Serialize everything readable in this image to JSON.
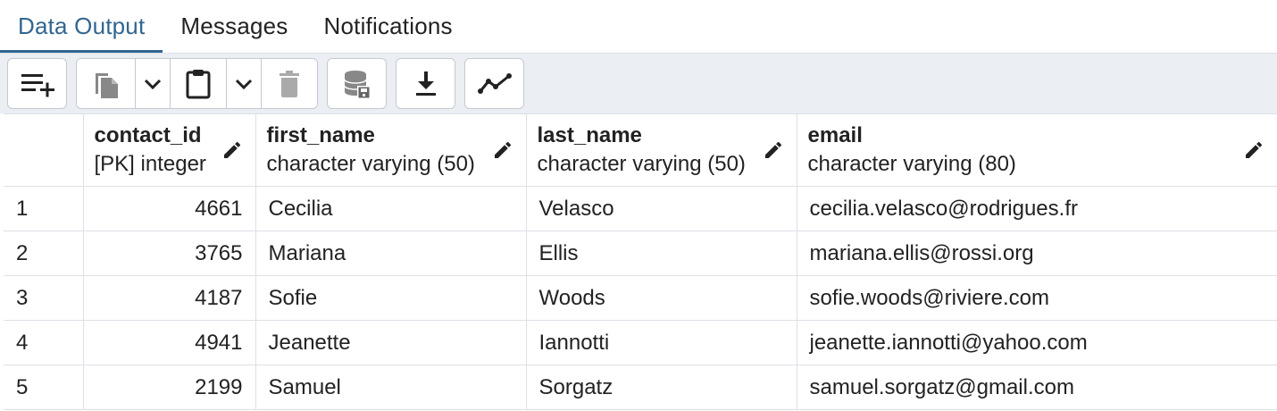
{
  "tabs": [
    {
      "label": "Data Output",
      "active": true
    },
    {
      "label": "Messages",
      "active": false
    },
    {
      "label": "Notifications",
      "active": false
    }
  ],
  "toolbar": {
    "buttons": [
      {
        "name": "add-row-icon"
      },
      {
        "name": "copy-icon"
      },
      {
        "name": "chevron-down-icon"
      },
      {
        "name": "paste-icon"
      },
      {
        "name": "chevron-down-icon"
      },
      {
        "name": "delete-icon"
      },
      {
        "name": "save-data-icon"
      },
      {
        "name": "download-icon"
      },
      {
        "name": "graph-icon"
      }
    ]
  },
  "columns": [
    {
      "name": "contact_id",
      "type": "[PK] integer"
    },
    {
      "name": "first_name",
      "type": "character varying (50)"
    },
    {
      "name": "last_name",
      "type": "character varying (50)"
    },
    {
      "name": "email",
      "type": "character varying (80)"
    }
  ],
  "rows": [
    {
      "num": "1",
      "contact_id": "4661",
      "first_name": "Cecilia",
      "last_name": "Velasco",
      "email": "cecilia.velasco@rodrigues.fr"
    },
    {
      "num": "2",
      "contact_id": "3765",
      "first_name": "Mariana",
      "last_name": "Ellis",
      "email": "mariana.ellis@rossi.org"
    },
    {
      "num": "3",
      "contact_id": "4187",
      "first_name": "Sofie",
      "last_name": "Woods",
      "email": "sofie.woods@riviere.com"
    },
    {
      "num": "4",
      "contact_id": "4941",
      "first_name": "Jeanette",
      "last_name": "Iannotti",
      "email": "jeanette.iannotti@yahoo.com"
    },
    {
      "num": "5",
      "contact_id": "2199",
      "first_name": "Samuel",
      "last_name": "Sorgatz",
      "email": "samuel.sorgatz@gmail.com"
    }
  ],
  "colors": {
    "accent": "#326690",
    "toolbar_bg": "#ebeef3",
    "border": "#dde0e6"
  }
}
